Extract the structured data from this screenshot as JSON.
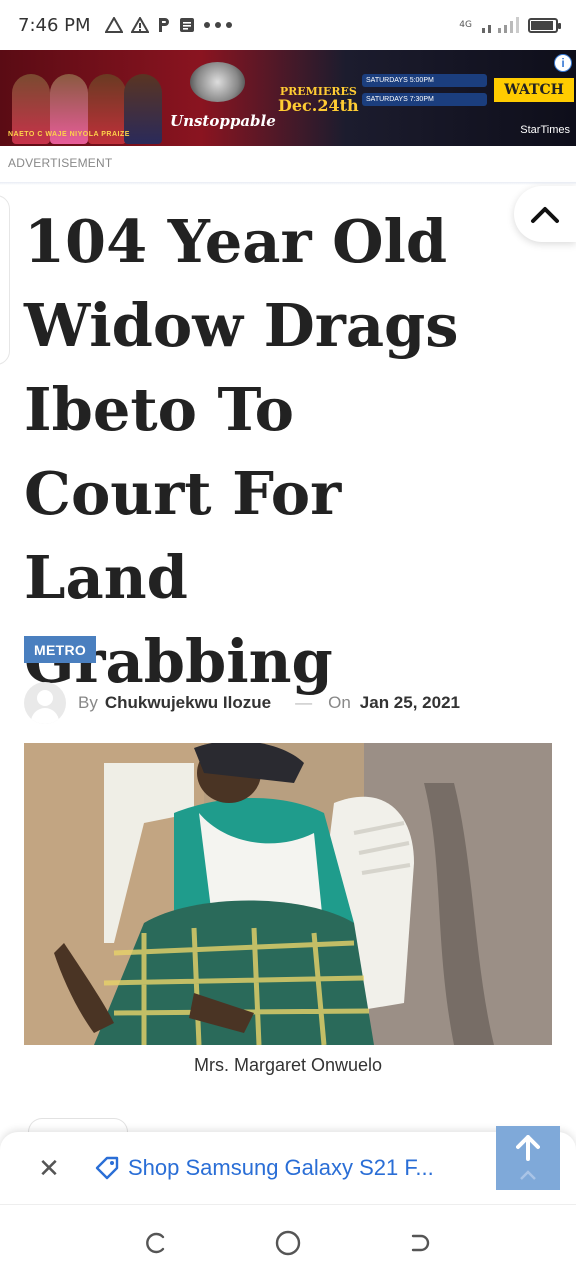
{
  "status_bar": {
    "time": "7:46 PM",
    "notification_icons": [
      "warning-outline-icon",
      "warning-icon",
      "p-icon",
      "message-icon",
      "more-dots-icon"
    ],
    "network": "4G",
    "battery_level": 0.85
  },
  "ad_banner": {
    "people_names": "NAETO C   WAJE   NIYOLA   PRAIZE",
    "show_logo_text": "Unstoppable",
    "premieres_line1": "PREMIERES",
    "premieres_line2": "Dec.24th",
    "schedule": [
      "SATURDAYS 5:00PM",
      "SATURDAYS 7:30PM"
    ],
    "watch_label": "WATCH",
    "brand": "StarTimes",
    "info_icon": "info-icon"
  },
  "advertisement_label": "ADVERTISEMENT",
  "article": {
    "title": "104 Year Old Widow Drags Ibeto To Court For Land Grabbing",
    "category": "METRO",
    "by_label": "By",
    "author": "Chukwujekwu Ilozue",
    "separator": "—",
    "on_label": "On",
    "date": "Jan 25, 2021",
    "image_caption": "Mrs. Margaret Onwuelo"
  },
  "bottom_bar": {
    "close_icon": "close-icon",
    "shop_link": "Shop Samsung Galaxy S21 F...",
    "tag_icon": "tag-icon"
  },
  "colors": {
    "category_bg": "#4a7fbf",
    "link": "#2a6ed6",
    "scroll_top_bg": "#7fa9d9"
  }
}
